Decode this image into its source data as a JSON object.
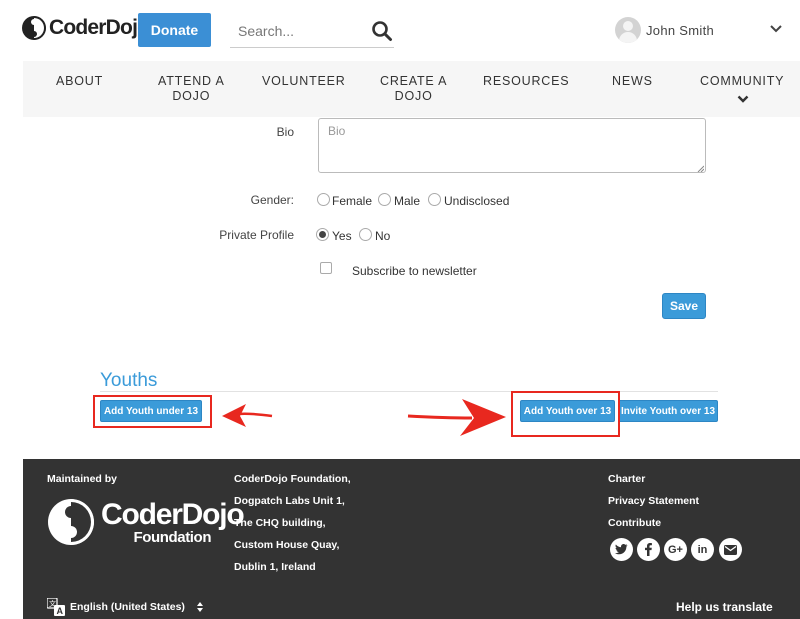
{
  "header": {
    "logo_text": "CoderDojo",
    "donate_label": "Donate",
    "search_placeholder": "Search...",
    "user_name": "John Smith"
  },
  "nav": {
    "items": [
      {
        "line1": "ABOUT",
        "line2": ""
      },
      {
        "line1": "ATTEND A",
        "line2": "DOJO"
      },
      {
        "line1": "VOLUNTEER",
        "line2": ""
      },
      {
        "line1": "CREATE A",
        "line2": "DOJO"
      },
      {
        "line1": "RESOURCES",
        "line2": ""
      },
      {
        "line1": "NEWS",
        "line2": ""
      },
      {
        "line1": "COMMUNITY",
        "line2": ""
      }
    ]
  },
  "form": {
    "bio_label": "Bio",
    "bio_placeholder": "Bio",
    "gender_label": "Gender:",
    "gender_options": [
      "Female",
      "Male",
      "Undisclosed"
    ],
    "private_label": "Private Profile",
    "private_options": [
      "Yes",
      "No"
    ],
    "private_selected": "Yes",
    "newsletter_label": "Subscribe to newsletter",
    "save_label": "Save"
  },
  "youths": {
    "title": "Youths",
    "add_under_13": "Add Youth under 13",
    "add_over_13": "Add Youth over 13",
    "invite_over_13": "Invite Youth over 13"
  },
  "annotation_color": "#e8281f",
  "footer": {
    "maintained_by": "Maintained by",
    "logo_name": "CoderDojo",
    "logo_sub": "Foundation",
    "address": [
      "CoderDojo Foundation,",
      "Dogpatch Labs Unit 1,",
      "The CHQ building,",
      "Custom House Quay,",
      "Dublin 1, Ireland"
    ],
    "links": [
      "Charter",
      "Privacy Statement",
      "Contribute"
    ],
    "social_icons": [
      "twitter-icon",
      "facebook-icon",
      "google-plus-icon",
      "linkedin-icon",
      "email-icon"
    ],
    "language": "English (United States)",
    "help_translate": "Help us translate"
  }
}
